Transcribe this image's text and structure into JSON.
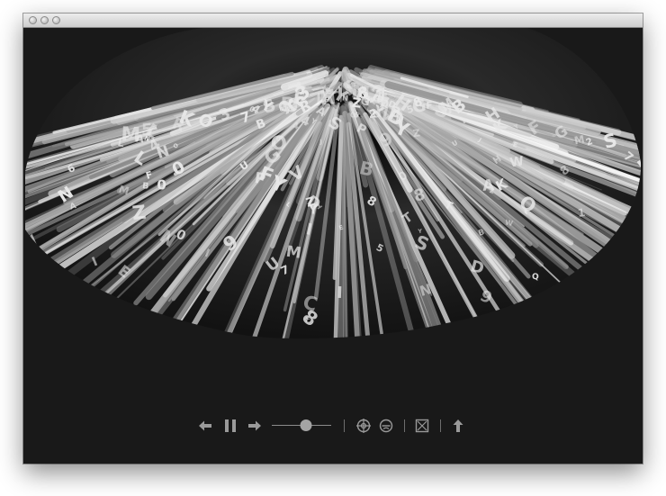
{
  "window": {
    "title": ""
  },
  "player": {
    "slider_value": 0.58
  },
  "icons": {
    "step_back": "arrow-left-icon",
    "pause": "pause-icon",
    "step_forward": "arrow-right-icon",
    "zoom_in": "crosshair-circle-icon",
    "zoom_out": "minus-circle-icon",
    "fullscreen": "box-x-icon",
    "export": "arrow-up-icon"
  },
  "colors": {
    "background": "#191919",
    "controls": "#9a9a9a"
  }
}
